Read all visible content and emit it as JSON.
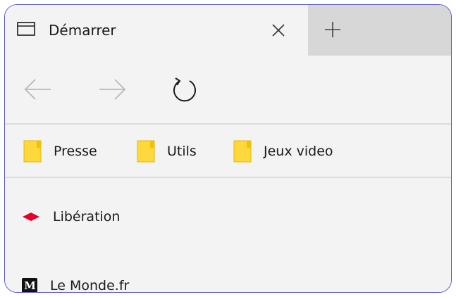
{
  "tab": {
    "title": "Démarrer",
    "icon": "tab-page-icon"
  },
  "toolbar": {
    "back_icon": "arrow-left-icon",
    "forward_icon": "arrow-right-icon",
    "refresh_icon": "refresh-icon",
    "close_icon": "close-icon",
    "new_tab_icon": "plus-icon"
  },
  "favorites": [
    {
      "label": "Presse",
      "icon": "folder-icon"
    },
    {
      "label": "Utils",
      "icon": "folder-icon"
    },
    {
      "label": "Jeux video",
      "icon": "folder-icon"
    }
  ],
  "items": [
    {
      "label": "Libération",
      "icon": "liberation-logo-icon"
    },
    {
      "label": "Le Monde.fr",
      "icon": "lemonde-logo-icon",
      "logo_text": "M"
    }
  ],
  "colors": {
    "folder": "#ffd93b",
    "liberation_red": "#e4002b",
    "window_border": "#5c5ad6"
  }
}
